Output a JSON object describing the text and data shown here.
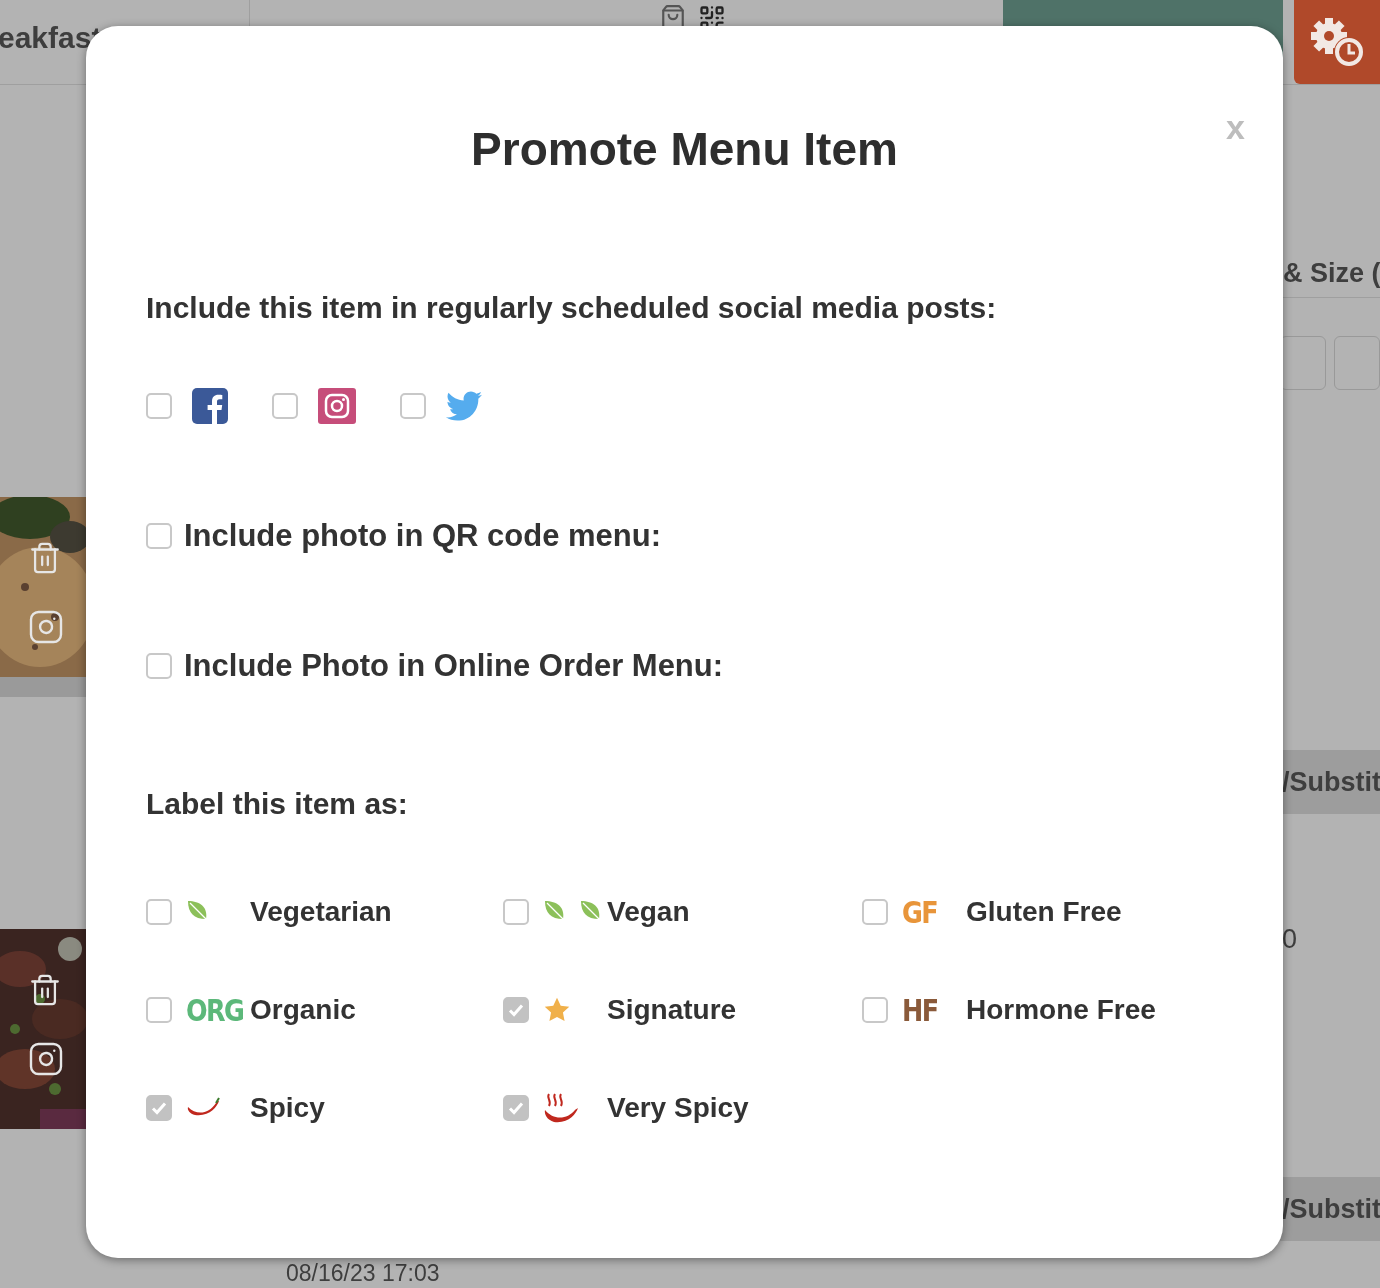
{
  "background": {
    "tabs": [
      {
        "label": "eakfast"
      }
    ],
    "header_fragment": "& Size (",
    "section_bands": [
      "/Substit",
      "/Substit"
    ],
    "value_fragment": "0",
    "timestamp": "08/16/23 17:03",
    "photos": [
      {
        "kind": "picture"
      },
      {
        "kind": "picture"
      }
    ]
  },
  "modal": {
    "title": "Promote Menu Item",
    "close": "x",
    "social_heading": "Include this item in regularly scheduled social media posts:",
    "social": [
      {
        "kind": "facebook",
        "checked": false
      },
      {
        "kind": "instagram",
        "checked": false
      },
      {
        "kind": "twitter",
        "checked": false
      }
    ],
    "options": [
      {
        "label": "Include photo in QR code menu:",
        "checked": false
      },
      {
        "label": "Include Photo in Online Order Menu:",
        "checked": false
      }
    ],
    "labels_heading": "Label this item as:",
    "labels": [
      {
        "kind": "leaf",
        "label": "Vegetarian",
        "checked": false
      },
      {
        "kind": "two-leaves",
        "label": "Vegan",
        "checked": false
      },
      {
        "kind": "badge",
        "badge": "GF",
        "color": "#e8953a",
        "label": "Gluten Free",
        "checked": false
      },
      {
        "kind": "badge",
        "badge": "ORG",
        "color": "#5cb87a",
        "label": "Organic",
        "checked": false
      },
      {
        "kind": "star",
        "label": "Signature",
        "checked": true
      },
      {
        "kind": "badge",
        "badge": "HF",
        "color": "#8a5a3a",
        "label": "Hormone Free",
        "checked": false
      },
      {
        "kind": "chili",
        "label": "Spicy",
        "checked": true
      },
      {
        "kind": "hot-chili",
        "label": "Very Spicy",
        "checked": true
      }
    ]
  }
}
